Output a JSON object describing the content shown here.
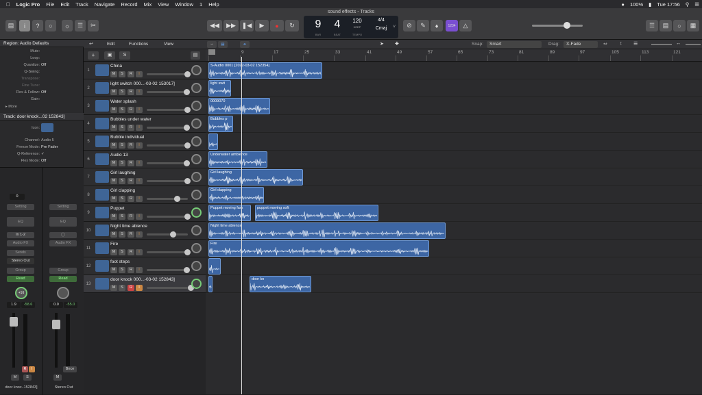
{
  "menubar": {
    "app": "Logic Pro",
    "items": [
      "File",
      "Edit",
      "Track",
      "Navigate",
      "Record",
      "Mix",
      "View",
      "Window",
      "1",
      "Help"
    ],
    "battery": "100%",
    "clock": "Tue 17:56"
  },
  "window": {
    "title": "sound effects - Tracks"
  },
  "lcd": {
    "bar": "9",
    "beat": "4",
    "bar_label": "BAR",
    "beat_label": "BEAT",
    "tempo": "120",
    "tempo_sub": "KEEP",
    "tempo_label": "TEMPO",
    "sig": "4/4",
    "key": "Cmaj"
  },
  "count_in": "1234",
  "inspector": {
    "region_header": "Region: Audio Defaults",
    "region_rows": [
      {
        "k": "Mute:",
        "v": ""
      },
      {
        "k": "Loop:",
        "v": ""
      },
      {
        "k": "Quantize:",
        "v": "Off"
      },
      {
        "k": "Q-Swing:",
        "v": ""
      },
      {
        "k": "Transpose:",
        "v": ""
      },
      {
        "k": "Fine Tune:",
        "v": ""
      },
      {
        "k": "Flex & Follow:",
        "v": "Off"
      },
      {
        "k": "Gain:",
        "v": ""
      }
    ],
    "more": "More",
    "track_header": "Track:  door knock...02 152843]",
    "track_rows": [
      {
        "k": "Icon:",
        "v": ""
      },
      {
        "k": "Channel:",
        "v": "Audio 5"
      },
      {
        "k": "Freeze Mode:",
        "v": "Pre Fader"
      },
      {
        "k": "Q-Reference:",
        "v": "✓"
      },
      {
        "k": "Flex Mode:",
        "v": "Off"
      }
    ],
    "strip1": {
      "input_val": "0",
      "setting": "Setting",
      "eq": "EQ",
      "input": "In 1-2",
      "audio_fx": "Audio FX",
      "sends": "Sends",
      "output": "Stereo Out",
      "group": "Group",
      "auto": "Read",
      "pan": "+16",
      "vol": "1.9",
      "peak": "-58.6",
      "name": "door knoc..152843]"
    },
    "strip2": {
      "setting": "Setting",
      "eq": "EQ",
      "audio_fx": "Audio FX",
      "group": "Group",
      "auto": "Read",
      "vol": "0.0",
      "peak": "-55.0",
      "bnce": "Bnce",
      "name": "Stereo Out"
    }
  },
  "tracks_header": {
    "edit": "Edit",
    "functions": "Functions",
    "view": "View"
  },
  "tracks": [
    {
      "num": "1",
      "name": "China"
    },
    {
      "num": "2",
      "name": "light switch 000...-03-02 153017]"
    },
    {
      "num": "3",
      "name": "Water splash"
    },
    {
      "num": "4",
      "name": "Bubbles under water"
    },
    {
      "num": "5",
      "name": "Bubble individual"
    },
    {
      "num": "6",
      "name": "Audio 13"
    },
    {
      "num": "7",
      "name": "Girl laughing"
    },
    {
      "num": "8",
      "name": "Girl clapping"
    },
    {
      "num": "9",
      "name": "Puppet"
    },
    {
      "num": "10",
      "name": "Night time abience"
    },
    {
      "num": "11",
      "name": "Fire"
    },
    {
      "num": "12",
      "name": "foot steps"
    },
    {
      "num": "13",
      "name": "door knock 000...-03-02 152843]"
    }
  ],
  "btn": {
    "m": "M",
    "s": "S",
    "r": "R",
    "i": "I"
  },
  "arrange_bar": {
    "snap_label": "Snap:",
    "snap": "Smart",
    "drag_label": "Drag:",
    "drag": "X-Fade"
  },
  "ruler": [
    "1",
    "9",
    "17",
    "25",
    "33",
    "41",
    "49",
    "57",
    "65",
    "73",
    "81",
    "89",
    "97",
    "105",
    "113",
    "121"
  ],
  "regions": [
    {
      "track": 0,
      "name": "S-Audio 0001 [2022-03-02 152354]"
    },
    {
      "track": 1,
      "name": "light swit"
    },
    {
      "track": 2,
      "name": "0009070"
    },
    {
      "track": 3,
      "name": "Bubbles p"
    },
    {
      "track": 4,
      "name": ""
    },
    {
      "track": 5,
      "name": "Underwater ambience"
    },
    {
      "track": 6,
      "name": "Girl laughing"
    },
    {
      "track": 7,
      "name": "Girl clapping"
    },
    {
      "track": 8,
      "name": "Puppet moving fars"
    },
    {
      "track": 8,
      "name": "puppet moving soft"
    },
    {
      "track": 9,
      "name": "Night time abience"
    },
    {
      "track": 10,
      "name": "Fire"
    },
    {
      "track": 11,
      "name": ""
    },
    {
      "track": 12,
      "name": ""
    },
    {
      "track": 12,
      "name": "door kn"
    }
  ]
}
